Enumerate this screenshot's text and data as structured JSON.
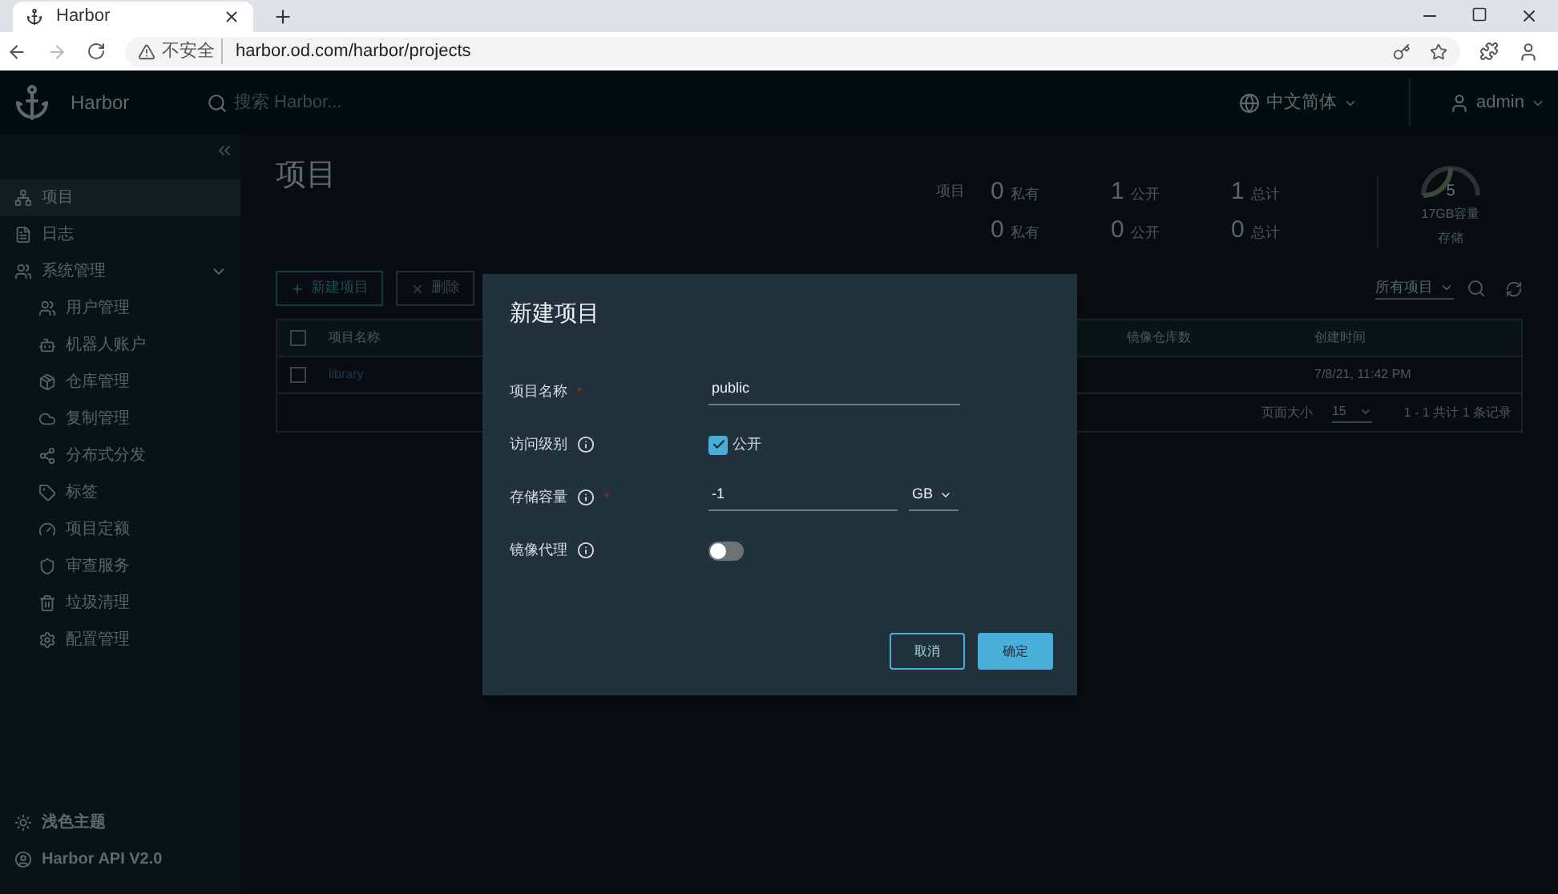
{
  "browser": {
    "tab_title": "Harbor",
    "security_label": "不安全",
    "url": "harbor.od.com/harbor/projects"
  },
  "header": {
    "brand": "Harbor",
    "search": {
      "placeholder": "搜索 Harbor..."
    },
    "language": "中文简体",
    "user": "admin"
  },
  "sidebar": {
    "items": [
      {
        "label": "项目",
        "selected": true
      },
      {
        "label": "日志",
        "selected": false
      },
      {
        "label": "系统管理",
        "selected": false,
        "expanded": true,
        "children": [
          {
            "label": "用户管理",
            "selected": false
          },
          {
            "label": "机器人账户",
            "selected": false
          },
          {
            "label": "仓库管理",
            "selected": false
          },
          {
            "label": "复制管理",
            "selected": false
          },
          {
            "label": "分布式分发",
            "selected": false
          },
          {
            "label": "标签",
            "selected": false
          },
          {
            "label": "项目定额",
            "selected": false
          },
          {
            "label": "审查服务",
            "selected": false
          },
          {
            "label": "垃圾清理",
            "selected": false
          },
          {
            "label": "配置管理",
            "selected": false
          }
        ]
      }
    ],
    "footer": [
      "浅色主题",
      "Harbor API V2.0"
    ]
  },
  "page": {
    "title": "项目",
    "stats": [
      {
        "label": "项目",
        "cells": [
          {
            "count": "0",
            "label": "私有"
          },
          {
            "count": "1",
            "label": "公开"
          },
          {
            "count": "1",
            "label": "总计"
          }
        ]
      },
      {
        "cells": [
          {
            "count": "0",
            "label": "私有"
          },
          {
            "count": "0",
            "label": "公开"
          },
          {
            "count": "0",
            "label": "总计"
          }
        ]
      }
    ],
    "storage": {
      "value": "5",
      "capacity": "17GB容量",
      "label": "存储",
      "level": 0.5
    },
    "toolbar": [
      "新建项目",
      "删除"
    ],
    "filter": "所有项目",
    "table": {
      "columns": [
        "项目名称",
        "镜像仓库数",
        "创建时间"
      ],
      "all_checked": false,
      "rows": [
        {
          "name": "library",
          "created": "7/8/21, 11:42 PM",
          "checked": false
        }
      ],
      "page_size_label": "页面大小",
      "page_size": "15",
      "summary": "1 - 1 共计 1 条记录"
    }
  },
  "dialog": {
    "title": "新建项目",
    "fields": [
      {
        "kind": "text",
        "label": "项目名称",
        "required_mark": "*",
        "info": false,
        "value": "public"
      },
      {
        "kind": "checkbox",
        "label": "访问级别",
        "info": true,
        "checked": true,
        "option": "公开"
      },
      {
        "kind": "quota",
        "label": "存储容量",
        "required_mark": "*",
        "info": true,
        "value": "-1",
        "unit": "GB"
      },
      {
        "kind": "switch",
        "label": "镜像代理",
        "info": true,
        "on": false
      }
    ],
    "buttons": [
      {
        "label": "取消",
        "kind": "secondary"
      },
      {
        "label": "确定",
        "kind": "primary"
      }
    ]
  }
}
